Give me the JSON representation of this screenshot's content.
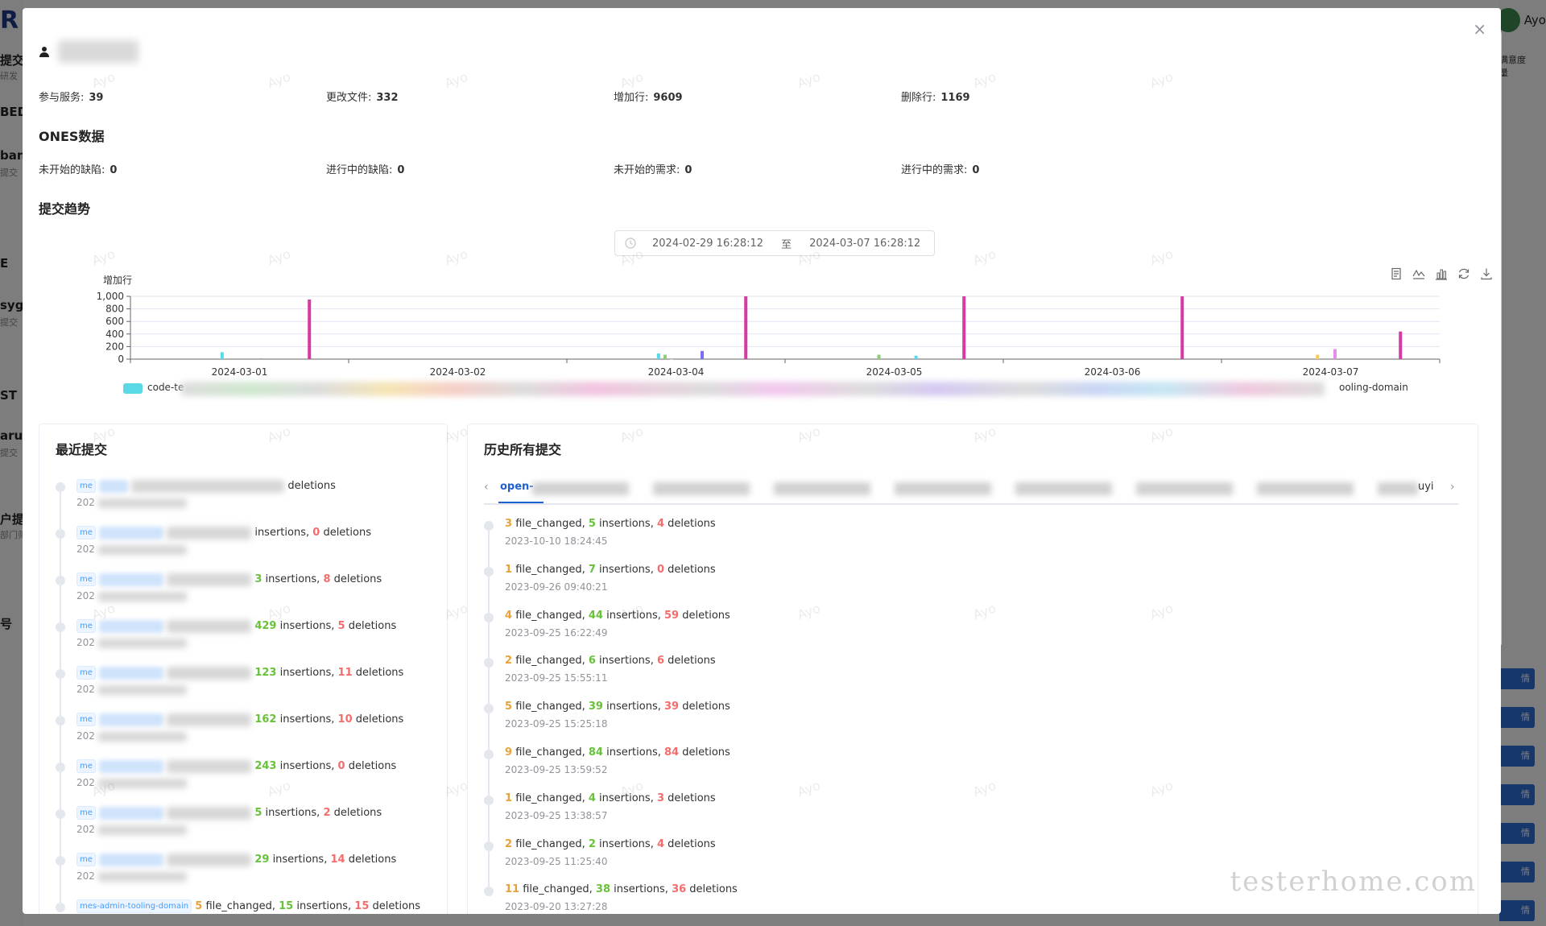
{
  "background": {
    "logo": "R",
    "left_items": [
      {
        "text": "提交",
        "small": "研发"
      },
      {
        "text": "BED",
        "small": ""
      },
      {
        "text": "ban",
        "small": "提交"
      },
      {
        "text": "E",
        "small": ""
      },
      {
        "text": "sygl",
        "small": "提交"
      },
      {
        "text": "ST",
        "small": ""
      },
      {
        "text": "arun",
        "small": "提交"
      },
      {
        "text": "户提交",
        "small": "部门筛"
      },
      {
        "text": "号",
        "small": ""
      }
    ],
    "right_user": "Ayo",
    "right_link": "满意度量",
    "right_btn": "情"
  },
  "modal": {
    "close_label": "×",
    "user_icon": "user-icon",
    "git_stats": [
      {
        "label": "参与服务:",
        "value": "39"
      },
      {
        "label": "更改文件:",
        "value": "332"
      },
      {
        "label": "增加行:",
        "value": "9609"
      },
      {
        "label": "删除行:",
        "value": "1169"
      }
    ],
    "ones_title": "ONES数据",
    "ones_stats": [
      {
        "label": "未开始的缺陷:",
        "value": "0"
      },
      {
        "label": "进行中的缺陷:",
        "value": "0"
      },
      {
        "label": "未开始的需求:",
        "value": "0"
      },
      {
        "label": "进行中的需求:",
        "value": "0"
      }
    ],
    "trend_title": "提交趋势",
    "date_range": {
      "start": "2024-02-29 16:28:12",
      "sep": "至",
      "end": "2024-03-07 16:28:12"
    },
    "toolbox_icons": [
      "data-view-icon",
      "line-chart-icon",
      "bar-chart-icon",
      "restore-icon",
      "download-icon"
    ],
    "legend": {
      "first": "code-te",
      "last": "ooling-domain"
    },
    "watermark": "Ayo",
    "brand_watermark": "testerhome.com"
  },
  "chart_data": {
    "type": "bar",
    "ylabel": "增加行",
    "ylim": [
      0,
      1000
    ],
    "yticks": [
      "1,000",
      "800",
      "600",
      "400",
      "200",
      "0"
    ],
    "categories": [
      "2024-03-01",
      "2024-03-02",
      "2024-03-04",
      "2024-03-05",
      "2024-03-06",
      "2024-03-07"
    ],
    "series": [
      {
        "name": "code-te",
        "color": "#5ad8e6",
        "points": [
          {
            "x": 0.42,
            "y": 110
          },
          {
            "x": 2.42,
            "y": 90
          },
          {
            "x": 3.6,
            "y": 55
          }
        ]
      },
      {
        "color": "#91cc75",
        "points": [
          {
            "x": 2.45,
            "y": 70
          },
          {
            "x": 3.43,
            "y": 70
          }
        ]
      },
      {
        "color": "#aaaaaa",
        "points": [
          {
            "x": 0.6,
            "y": 15
          },
          {
            "x": 2.48,
            "y": 0
          }
        ]
      },
      {
        "color": "#7b6ef2",
        "points": [
          {
            "x": 2.62,
            "y": 130
          }
        ]
      },
      {
        "color": "#fac858",
        "points": [
          {
            "x": 5.44,
            "y": 70
          }
        ]
      },
      {
        "color": "#e58ee8",
        "points": [
          {
            "x": 5.52,
            "y": 160
          }
        ]
      },
      {
        "name": "ooling-domain",
        "color": "#d63aa3",
        "points": [
          {
            "x": 0.82,
            "y": 950
          },
          {
            "x": 2.82,
            "y": 1000
          },
          {
            "x": 3.82,
            "y": 1000
          },
          {
            "x": 4.82,
            "y": 1000
          },
          {
            "x": 5.82,
            "y": 440
          }
        ]
      }
    ]
  },
  "recent": {
    "title": "最近提交",
    "items": [
      {
        "tag": "me",
        "show_files": false,
        "show_ins": false,
        "ins": "",
        "del": "",
        "tail": "deletions",
        "time": "202"
      },
      {
        "tag": "me",
        "show_files": false,
        "show_ins": true,
        "ins": "",
        "del": "0",
        "tail": "deletions",
        "time": "202"
      },
      {
        "tag": "me",
        "show_files": false,
        "show_ins": true,
        "ins": "3",
        "del": "8",
        "tail": "deletions",
        "time": "202"
      },
      {
        "tag": "me",
        "show_files": false,
        "show_ins": true,
        "ins": "429",
        "del": "5",
        "tail": "deletions",
        "time": "202"
      },
      {
        "tag": "me",
        "show_files": false,
        "show_ins": true,
        "ins": "123",
        "del": "11",
        "tail": "deletions",
        "time": "202"
      },
      {
        "tag": "me",
        "show_files": false,
        "show_ins": true,
        "ins": "162",
        "del": "10",
        "tail": "deletions",
        "time": "202"
      },
      {
        "tag": "me",
        "show_files": false,
        "show_ins": true,
        "ins": "243",
        "del": "0",
        "tail": "deletions",
        "time": "202"
      },
      {
        "tag": "me",
        "show_files": false,
        "show_ins": true,
        "ins": "5",
        "del": "2",
        "tail": "deletions",
        "time": "202"
      },
      {
        "tag": "me",
        "show_files": false,
        "show_ins": true,
        "ins": "29",
        "del": "14",
        "tail": "deletions",
        "time": "202"
      },
      {
        "tag": "mes-admin-tooling-domain",
        "show_files": true,
        "files": "5",
        "ins": "15",
        "del": "15",
        "tail": "deletions",
        "time": ""
      }
    ]
  },
  "history": {
    "title": "历史所有提交",
    "tab_active": "open-",
    "tab_last": "uyi",
    "items": [
      {
        "files": "3",
        "ins": "5",
        "del": "4",
        "time": "2023-10-10 18:24:45"
      },
      {
        "files": "1",
        "ins": "7",
        "del": "0",
        "time": "2023-09-26 09:40:21"
      },
      {
        "files": "4",
        "ins": "44",
        "del": "59",
        "time": "2023-09-25 16:22:49"
      },
      {
        "files": "2",
        "ins": "6",
        "del": "6",
        "time": "2023-09-25 15:55:11"
      },
      {
        "files": "5",
        "ins": "39",
        "del": "39",
        "time": "2023-09-25 15:25:18"
      },
      {
        "files": "9",
        "ins": "84",
        "del": "84",
        "time": "2023-09-25 13:59:52"
      },
      {
        "files": "1",
        "ins": "4",
        "del": "3",
        "time": "2023-09-25 13:38:57"
      },
      {
        "files": "2",
        "ins": "2",
        "del": "4",
        "time": "2023-09-25 11:25:40"
      },
      {
        "files": "11",
        "ins": "38",
        "del": "36",
        "time": "2023-09-20 13:27:28"
      }
    ]
  },
  "labels": {
    "file_changed": "file_changed,",
    "insertions": "insertions,",
    "deletions": "deletions"
  }
}
